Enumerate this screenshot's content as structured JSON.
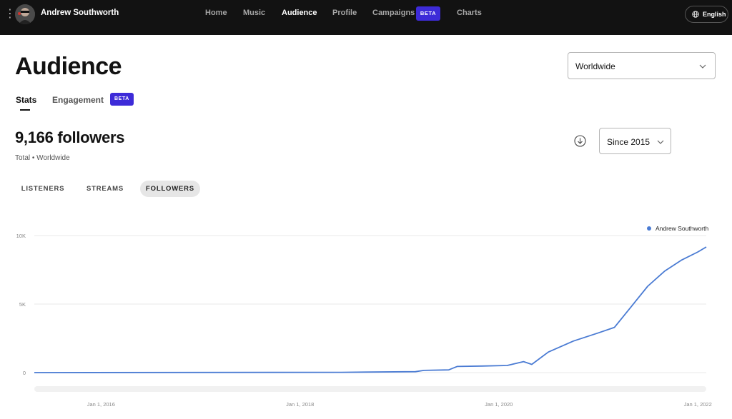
{
  "topbar": {
    "artist_name": "Andrew Southworth",
    "nav": [
      "Home",
      "Music",
      "Audience",
      "Profile",
      "Campaigns",
      "Charts"
    ],
    "active_nav": "Audience",
    "campaigns_badge": "BETA",
    "language": "English"
  },
  "page": {
    "title": "Audience",
    "region": "Worldwide",
    "tabs": [
      "Stats",
      "Engagement"
    ],
    "active_tab": "Stats",
    "engagement_badge": "BETA",
    "followers_total": "9,166 followers",
    "followers_sub": "Total • Worldwide",
    "range": "Since 2015",
    "metric_pills": [
      "LISTENERS",
      "STREAMS",
      "FOLLOWERS"
    ],
    "active_pill": "FOLLOWERS"
  },
  "colors": {
    "topbar_bg": "#121212",
    "accent_beta": "#3d2bd8",
    "series_line": "#4a7bd3"
  },
  "chart_data": {
    "type": "line",
    "legend": "top-right",
    "grid": true,
    "y_ticks": [
      "0",
      "5K",
      "10K"
    ],
    "ylim": [
      0,
      10000
    ],
    "x_ticks": [
      "Jan 1, 2016",
      "Jan 1, 2018",
      "Jan 1, 2020",
      "Jan 1, 2022"
    ],
    "xlim": [
      "2015-05-01",
      "2022-02-01"
    ],
    "series": [
      {
        "name": "Andrew Southworth",
        "points": [
          [
            "2015-05-01",
            0
          ],
          [
            "2018-06-01",
            20
          ],
          [
            "2019-03-01",
            70
          ],
          [
            "2019-04-01",
            160
          ],
          [
            "2019-07-01",
            200
          ],
          [
            "2019-08-01",
            450
          ],
          [
            "2019-11-01",
            480
          ],
          [
            "2020-02-01",
            520
          ],
          [
            "2020-04-01",
            800
          ],
          [
            "2020-05-01",
            600
          ],
          [
            "2020-07-01",
            1500
          ],
          [
            "2020-10-01",
            2300
          ],
          [
            "2021-01-01",
            2900
          ],
          [
            "2021-03-01",
            3300
          ],
          [
            "2021-05-01",
            4800
          ],
          [
            "2021-07-01",
            6300
          ],
          [
            "2021-09-01",
            7400
          ],
          [
            "2021-11-01",
            8200
          ],
          [
            "2022-01-01",
            8800
          ],
          [
            "2022-02-01",
            9166
          ]
        ]
      }
    ]
  }
}
